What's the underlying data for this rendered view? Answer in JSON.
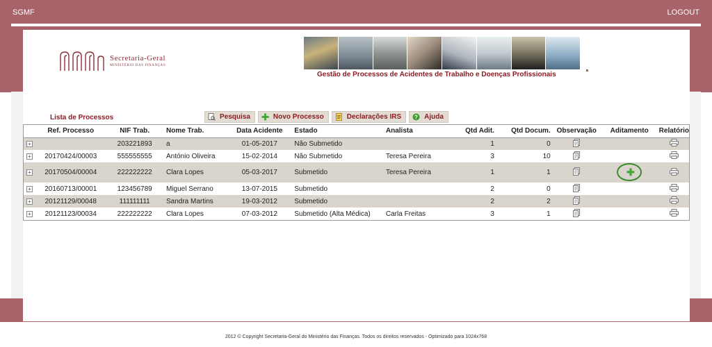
{
  "header": {
    "brand": "SGMF",
    "logout": "LOGOUT",
    "logo_line1": "Secretaria-Geral",
    "logo_line2": "MINISTÉRIO DAS FINANÇAS",
    "banner_title": "Gestão de Processos de Acidentes de Trabalho e Doenças Profissionais"
  },
  "list_title": "Lista de Processos",
  "toolbar": [
    {
      "label": "Pesquisa",
      "icon": "search-doc-icon"
    },
    {
      "label": "Novo Processo",
      "icon": "green-plus-icon"
    },
    {
      "label": "Declarações IRS",
      "icon": "document-icon"
    },
    {
      "label": "Ajuda",
      "icon": "help-icon"
    }
  ],
  "table": {
    "columns": [
      "Ref. Processo",
      "NIF Trab.",
      "Nome Trab.",
      "Data Acidente",
      "Estado",
      "Analista",
      "Qtd Adit.",
      "Qtd Docum.",
      "Observação",
      "Aditamento",
      "Relatório"
    ],
    "rows": [
      {
        "ref": "",
        "nif": "203221893",
        "nome": "a",
        "data": "01-05-2017",
        "estado": "Não Submetido",
        "analista": "",
        "qtd_adit": "1",
        "qtd_doc": "0",
        "aditamento": ""
      },
      {
        "ref": "20170424/00003",
        "nif": "555555555",
        "nome": "António Oliveira",
        "data": "15-02-2014",
        "estado": "Não Submetido",
        "analista": "Teresa Pereira",
        "qtd_adit": "3",
        "qtd_doc": "10",
        "aditamento": ""
      },
      {
        "ref": "20170504/00004",
        "nif": "222222222",
        "nome": "Clara Lopes",
        "data": "05-03-2017",
        "estado": "Submetido",
        "analista": "Teresa Pereira",
        "qtd_adit": "1",
        "qtd_doc": "1",
        "aditamento": "add"
      },
      {
        "ref": "20160713/00001",
        "nif": "123456789",
        "nome": "Miguel Serrano",
        "data": "13-07-2015",
        "estado": "Submetido",
        "analista": "",
        "qtd_adit": "2",
        "qtd_doc": "0",
        "aditamento": ""
      },
      {
        "ref": "20121129/00048",
        "nif": "111111111",
        "nome": "Sandra Martins",
        "data": "19-03-2012",
        "estado": "Submetido",
        "analista": "",
        "qtd_adit": "2",
        "qtd_doc": "2",
        "aditamento": ""
      },
      {
        "ref": "20121123/00034",
        "nif": "222222222",
        "nome": "Clara Lopes",
        "data": "07-03-2012",
        "estado": "Submetido (Alta Médica)",
        "analista": "Carla Freitas",
        "qtd_adit": "3",
        "qtd_doc": "1",
        "aditamento": ""
      }
    ]
  },
  "footer": "2012 © Copyright Secretaria-Geral do Ministério das Finanças. Todos os direitos reservados - Optimizado para 1024x768",
  "colors": {
    "brand_bar": "#a8636a",
    "title_red": "#8a1d25",
    "row_alt": "#d9d5cd",
    "add_green": "#46a83a"
  }
}
